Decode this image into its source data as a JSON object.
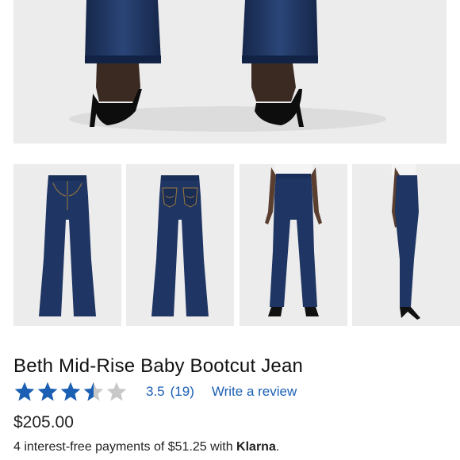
{
  "product": {
    "title": "Beth Mid-Rise Baby Bootcut Jean",
    "rating": {
      "value": 3.5,
      "value_label": "3.5",
      "max": 5,
      "count_label": "(19)",
      "write_review_label": "Write a review",
      "star_color": "#1a5fb4",
      "empty_star_color": "#c8c8c8"
    },
    "price": "$205.00",
    "installments": {
      "text": "4 interest-free payments of $51.25 with ",
      "brand": "Klarna",
      "suffix": "."
    }
  },
  "gallery": {
    "background": "#ececec",
    "denim_color": "#1f3563",
    "thumbnails": [
      {
        "view": "front-flat"
      },
      {
        "view": "back-flat"
      },
      {
        "view": "model-front"
      },
      {
        "view": "model-side"
      }
    ]
  }
}
